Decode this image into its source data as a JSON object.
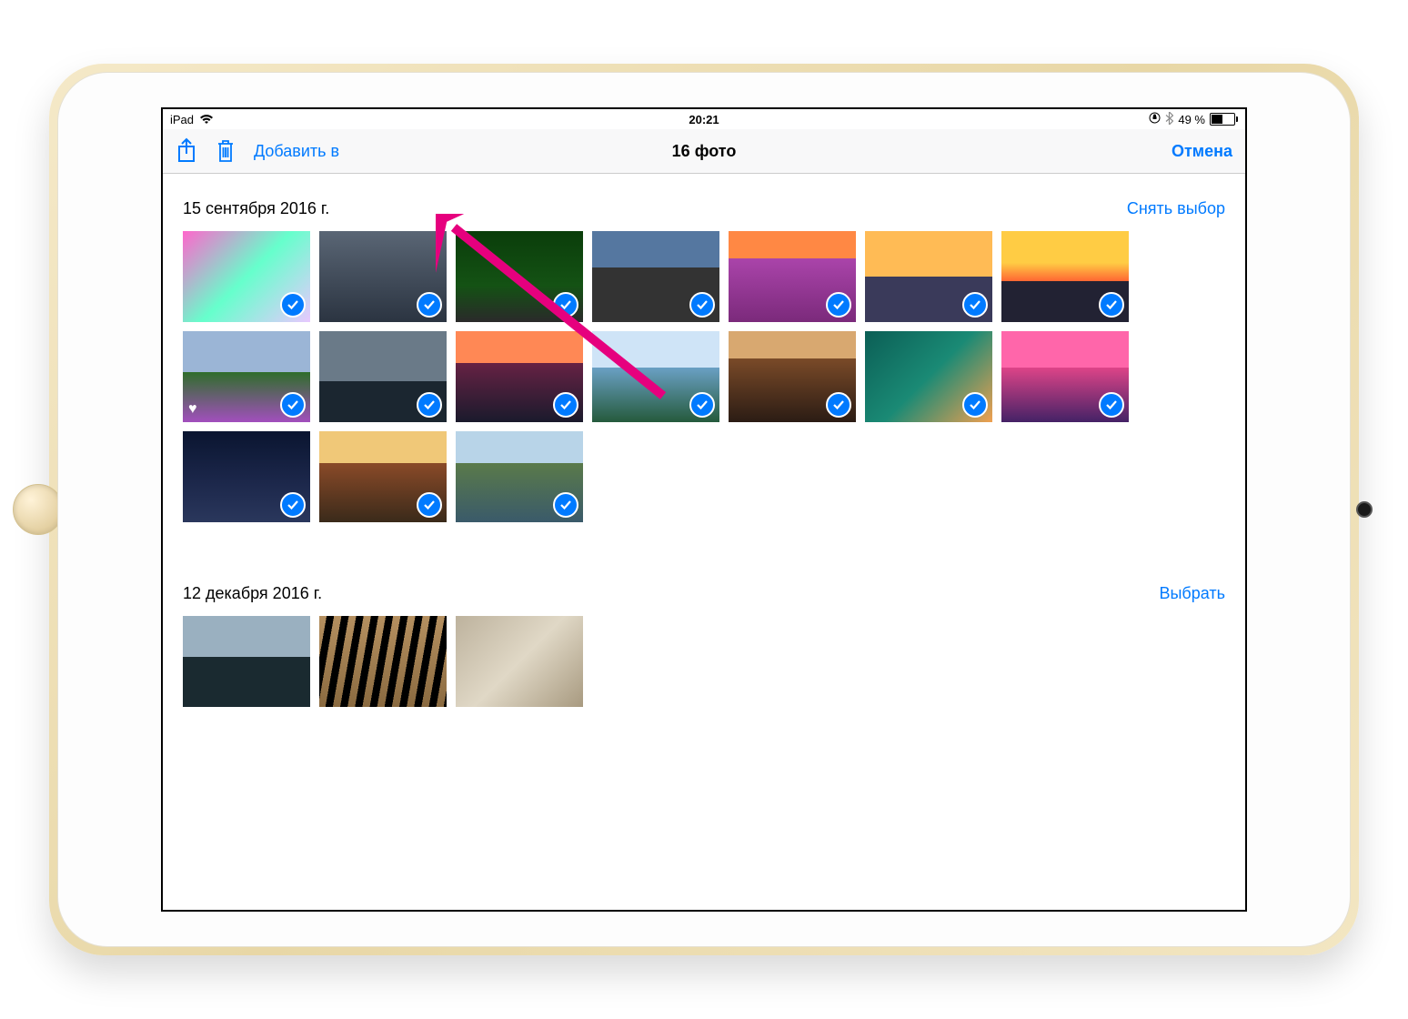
{
  "status": {
    "device": "iPad",
    "time": "20:21",
    "battery_text": "49 %"
  },
  "nav": {
    "add_to": "Добавить в",
    "title": "16 фото",
    "cancel": "Отмена"
  },
  "sections": [
    {
      "date": "15 сентября 2016 г.",
      "action": "Снять выбор",
      "photos": [
        {
          "g": "g1",
          "selected": true
        },
        {
          "g": "g2",
          "selected": true
        },
        {
          "g": "g3",
          "selected": true
        },
        {
          "g": "g4",
          "selected": true
        },
        {
          "g": "g5",
          "selected": true
        },
        {
          "g": "g6",
          "selected": true
        },
        {
          "g": "g7",
          "selected": true
        },
        {
          "g": "g8",
          "selected": true,
          "favorite": true
        },
        {
          "g": "g9",
          "selected": true
        },
        {
          "g": "g10",
          "selected": true
        },
        {
          "g": "g11",
          "selected": true
        },
        {
          "g": "g12",
          "selected": true
        },
        {
          "g": "g13",
          "selected": true
        },
        {
          "g": "g14",
          "selected": true
        },
        {
          "g": "g15",
          "selected": true
        },
        {
          "g": "g16",
          "selected": true
        },
        {
          "g": "g17",
          "selected": true
        }
      ]
    },
    {
      "date": "12 декабря 2016 г.",
      "action": "Выбрать",
      "photos": [
        {
          "g": "g18",
          "selected": false
        },
        {
          "g": "g19",
          "selected": false
        },
        {
          "g": "g20",
          "selected": false
        }
      ]
    }
  ],
  "colors": {
    "accent": "#007aff"
  }
}
